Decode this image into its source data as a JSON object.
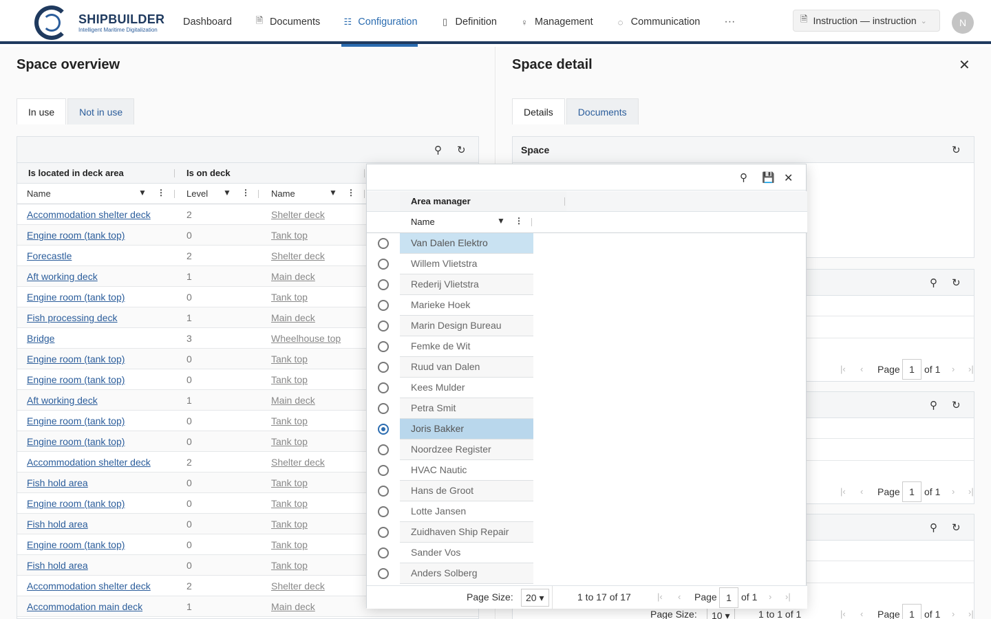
{
  "brand": {
    "name": "SHIPBUILDER",
    "tagline": "Intelligent Maritime Digitalization"
  },
  "nav": [
    {
      "label": "Dashboard",
      "icon": "none",
      "active": false
    },
    {
      "label": "Documents",
      "icon": "document-icon",
      "active": false
    },
    {
      "label": "Configuration",
      "icon": "hierarchy-icon",
      "active": true
    },
    {
      "label": "Definition",
      "icon": "book-icon",
      "active": false
    },
    {
      "label": "Management",
      "icon": "user-icon",
      "active": false
    },
    {
      "label": "Communication",
      "icon": "chat-icon",
      "active": false
    }
  ],
  "nav_more": "···",
  "instruction_select": "Instruction — instruction",
  "avatar_initial": "N",
  "left": {
    "title": "Space overview",
    "tabs": [
      "In use",
      "Not in use"
    ],
    "group_headers": [
      "Is located in deck area",
      "Is on deck"
    ],
    "columns": [
      "Name",
      "Level",
      "Name"
    ],
    "rows": [
      {
        "area": "Accommodation shelter deck",
        "level": "2",
        "deck": "Shelter deck"
      },
      {
        "area": "Engine room (tank top)",
        "level": "0",
        "deck": "Tank top"
      },
      {
        "area": "Forecastle",
        "level": "2",
        "deck": "Shelter deck"
      },
      {
        "area": "Aft working deck",
        "level": "1",
        "deck": "Main deck"
      },
      {
        "area": "Engine room (tank top)",
        "level": "0",
        "deck": "Tank top"
      },
      {
        "area": "Fish processing deck",
        "level": "1",
        "deck": "Main deck"
      },
      {
        "area": "Bridge",
        "level": "3",
        "deck": "Wheelhouse top"
      },
      {
        "area": "Engine room (tank top)",
        "level": "0",
        "deck": "Tank top"
      },
      {
        "area": "Engine room (tank top)",
        "level": "0",
        "deck": "Tank top"
      },
      {
        "area": "Aft working deck",
        "level": "1",
        "deck": "Main deck"
      },
      {
        "area": "Engine room (tank top)",
        "level": "0",
        "deck": "Tank top"
      },
      {
        "area": "Engine room (tank top)",
        "level": "0",
        "deck": "Tank top"
      },
      {
        "area": "Accommodation shelter deck",
        "level": "2",
        "deck": "Shelter deck"
      },
      {
        "area": "Fish hold area",
        "level": "0",
        "deck": "Tank top"
      },
      {
        "area": "Engine room (tank top)",
        "level": "0",
        "deck": "Tank top"
      },
      {
        "area": "Fish hold area",
        "level": "0",
        "deck": "Tank top"
      },
      {
        "area": "Engine room (tank top)",
        "level": "0",
        "deck": "Tank top"
      },
      {
        "area": "Fish hold area",
        "level": "0",
        "deck": "Tank top"
      },
      {
        "area": "Accommodation shelter deck",
        "level": "2",
        "deck": "Shelter deck"
      },
      {
        "area": "Accommodation main deck",
        "level": "1",
        "deck": "Main deck"
      }
    ]
  },
  "right": {
    "title": "Space detail",
    "tabs": [
      "Details",
      "Documents"
    ],
    "space_card_title": "Space",
    "pager": {
      "page_label": "Page",
      "page": "1",
      "of": "of 1"
    },
    "bottom_pager": {
      "size_label": "Page Size:",
      "size": "10",
      "range": "1 to 1 of 1",
      "page_label": "Page",
      "page": "1",
      "of": "of 1"
    }
  },
  "popup": {
    "group_header": "Area manager",
    "column": "Name",
    "rows": [
      {
        "name": "Van Dalen Elektro",
        "selected": false,
        "highlight": true
      },
      {
        "name": "Willem Vlietstra",
        "selected": false
      },
      {
        "name": "Rederij Vlietstra",
        "selected": false
      },
      {
        "name": "Marieke Hoek",
        "selected": false
      },
      {
        "name": "Marin Design Bureau",
        "selected": false
      },
      {
        "name": "Femke de Wit",
        "selected": false
      },
      {
        "name": "Ruud van Dalen",
        "selected": false
      },
      {
        "name": "Kees Mulder",
        "selected": false
      },
      {
        "name": "Petra Smit",
        "selected": false
      },
      {
        "name": "Joris Bakker",
        "selected": true
      },
      {
        "name": "Noordzee Register",
        "selected": false
      },
      {
        "name": "HVAC Nautic",
        "selected": false
      },
      {
        "name": "Hans de Groot",
        "selected": false
      },
      {
        "name": "Lotte Jansen",
        "selected": false
      },
      {
        "name": "Zuidhaven Ship Repair",
        "selected": false
      },
      {
        "name": "Sander Vos",
        "selected": false
      },
      {
        "name": "Anders Solberg",
        "selected": false
      }
    ],
    "footer": {
      "size_label": "Page Size:",
      "size": "20",
      "range": "1 to 17 of 17",
      "page_label": "Page",
      "page": "1",
      "of": "of 1"
    }
  },
  "colors": {
    "brand": "#1f3a5f",
    "accent": "#2b6cb0",
    "selection": "#c9e2f2"
  }
}
